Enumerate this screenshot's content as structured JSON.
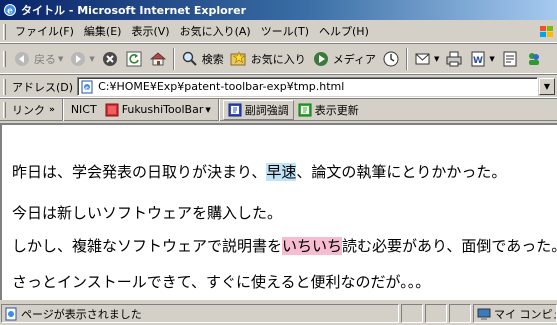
{
  "window": {
    "title": "タイトル - Microsoft Internet Explorer"
  },
  "menu": {
    "items": [
      "ファイル(F)",
      "編集(E)",
      "表示(V)",
      "お気に入り(A)",
      "ツール(T)",
      "ヘルプ(H)"
    ]
  },
  "toolbar": {
    "back": "戻る",
    "search": "検索",
    "favorites": "お気に入り",
    "media": "メディア"
  },
  "address": {
    "label": "アドレス(D)",
    "value": "C:¥HOME¥Exp¥patent-toolbar-exp¥tmp.html"
  },
  "links": {
    "label": "リンク",
    "chevron": "»",
    "items": [
      "NICT",
      "FukushiToolBar",
      "副詞強調",
      "表示更新"
    ]
  },
  "content": {
    "p1": {
      "before": "昨日は、学会発表の日取りが決まり、",
      "highlight": "早速",
      "after": "、論文の執筆にとりかかった。"
    },
    "p2": "今日は新しいソフトウェアを購入した。",
    "p3": {
      "before": "しかし、複雑なソフトウェアで説明書を",
      "highlight": "いちいち",
      "after": "読む必要があり、面倒であった。"
    },
    "p4": "さっとインストールできて、すぐに使えると便利なのだが。。。"
  },
  "status": {
    "text": "ページが表示されました",
    "zone": "マイ コンピュータ"
  },
  "colors": {
    "highlight_blue": "#bfe4f8",
    "highlight_pink": "#f7bcd0",
    "titlebar": "#0a246a"
  }
}
